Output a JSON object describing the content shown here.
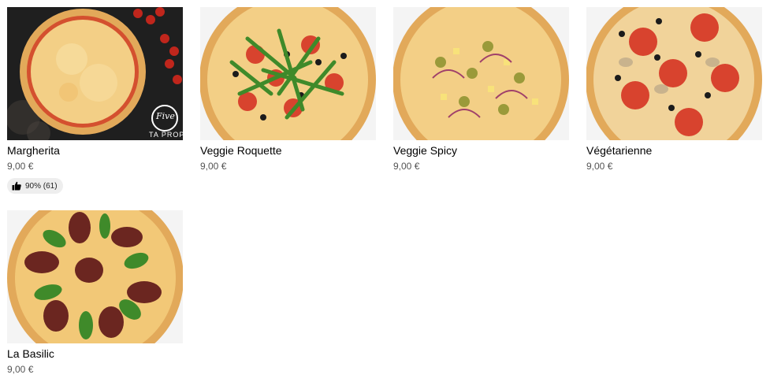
{
  "menu": {
    "items": [
      {
        "name": "Margherita",
        "price": "9,00 €",
        "rating": "90% (61)",
        "image_label": "Pizza Margherita",
        "logo_text": "Five",
        "logo_caption": "TA PROPRE"
      },
      {
        "name": "Veggie Roquette",
        "price": "9,00 €",
        "image_label": "Pizza Veggie Roquette"
      },
      {
        "name": "Veggie Spicy",
        "price": "9,00 €",
        "image_label": "Pizza Veggie Spicy"
      },
      {
        "name": "Végétarienne",
        "price": "9,00 €",
        "image_label": "Pizza Végétarienne"
      },
      {
        "name": "La Basilic",
        "price": "9,00 €",
        "image_label": "Pizza La Basilic"
      }
    ]
  },
  "colors": {
    "title_text": "#000000",
    "price_text": "#545454",
    "badge_background": "#eeeeee",
    "crust": "#e2a95a",
    "cheese": "#f3cf86",
    "tomato": "#d8432e",
    "rocket": "#3f8a2a",
    "olive": "#1b1b1b",
    "dark_board": "#1f1f1f"
  },
  "icons": {
    "rating": "thumbs-up-icon"
  }
}
